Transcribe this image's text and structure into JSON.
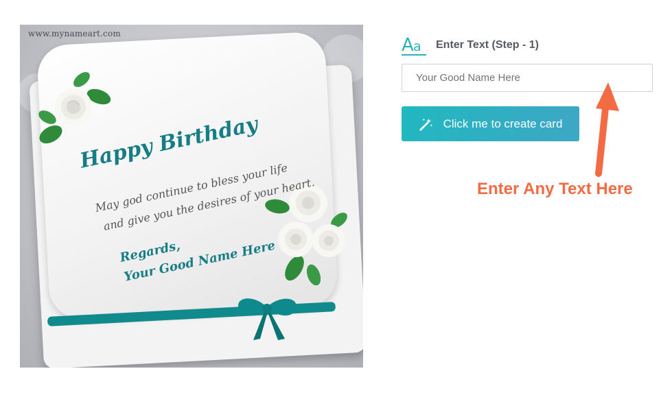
{
  "card_preview": {
    "watermark": "www.mynameart.com",
    "title": "Happy Birthday",
    "message_line1": "May god continue to bless your life",
    "message_line2": "and give you the desires of your heart.",
    "regards": "Regards,",
    "name": "Your Good Name Here"
  },
  "form": {
    "step_label": "Enter Text (Step - 1)",
    "font_icon_glyph": "Aa",
    "name_input_placeholder": "Your Good Name Here",
    "name_input_value": "",
    "create_button_label": "Click me to create card",
    "hint_text": "Enter Any Text Here"
  },
  "icons": {
    "font_icon": "font-icon",
    "wand_icon": "magic-wand-icon",
    "arrow": "arrow-up-icon"
  },
  "colors": {
    "accent": "#21b8c0",
    "hint": "#f26b43",
    "card_teal": "#177d85"
  }
}
